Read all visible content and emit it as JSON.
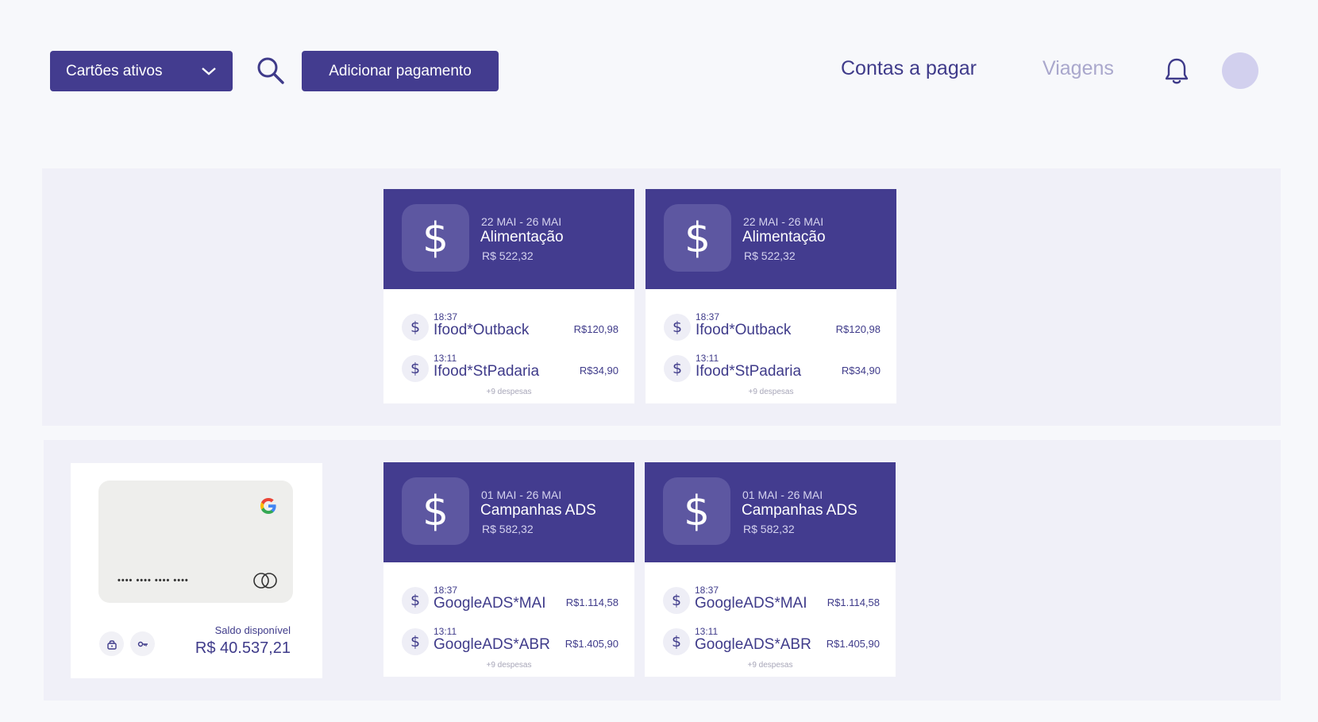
{
  "toolbar": {
    "filter_label": "Cartões ativos",
    "add_label": "Adicionar pagamento"
  },
  "nav": {
    "contas": "Contas a pagar",
    "viagens": "Viagens"
  },
  "colors": {
    "brand": "#433c8f",
    "brand_light": "#5d57a1",
    "inactive_nav": "#a9a7cc",
    "avatar": "#d2d0ee"
  },
  "groups": [
    {
      "cards": [
        {
          "icon": "dollar-icon",
          "dates": "22 MAI - 26 MAI",
          "category": "Alimentação",
          "amount": "R$ 522,32",
          "expenses": [
            {
              "time": "18:37",
              "merchant": "Ifood*Outback",
              "value": "R$120,98"
            },
            {
              "time": "13:11",
              "merchant": "Ifood*StPadaria",
              "value": "R$34,90"
            }
          ],
          "more": "+9 despesas"
        },
        {
          "icon": "dollar-icon",
          "dates": "22 MAI - 26 MAI",
          "category": "Alimentação",
          "amount": "R$ 522,32",
          "expenses": [
            {
              "time": "18:37",
              "merchant": "Ifood*Outback",
              "value": "R$120,98"
            },
            {
              "time": "13:11",
              "merchant": "Ifood*StPadaria",
              "value": "R$34,90"
            }
          ],
          "more": "+9 despesas"
        }
      ]
    },
    {
      "credit_card": {
        "masked_number": "•••• •••• •••• ••••",
        "saldo_label": "Saldo disponível",
        "saldo_value": "R$ 40.537,21"
      },
      "cards": [
        {
          "icon": "dollar-icon",
          "dates": "01 MAI - 26 MAI",
          "category": "Campanhas ADS",
          "amount": "R$ 582,32",
          "expenses": [
            {
              "time": "18:37",
              "merchant": "GoogleADS*MAI",
              "value": "R$1.114,58"
            },
            {
              "time": "13:11",
              "merchant": "GoogleADS*ABR",
              "value": "R$1.405,90"
            }
          ],
          "more": "+9 despesas"
        },
        {
          "icon": "dollar-icon",
          "dates": "01 MAI - 26 MAI",
          "category": "Campanhas ADS",
          "amount": "R$ 582,32",
          "expenses": [
            {
              "time": "18:37",
              "merchant": "GoogleADS*MAI",
              "value": "R$1.114,58"
            },
            {
              "time": "13:11",
              "merchant": "GoogleADS*ABR",
              "value": "R$1.405,90"
            }
          ],
          "more": "+9 despesas"
        }
      ]
    }
  ]
}
